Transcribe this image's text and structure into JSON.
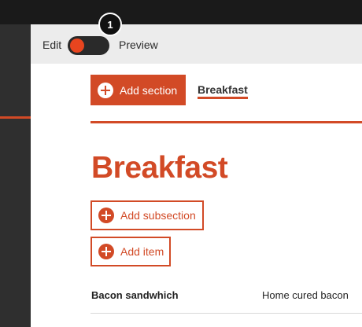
{
  "mode_switch": {
    "edit_label": "Edit",
    "preview_label": "Preview",
    "state": "edit"
  },
  "step_badge": "1",
  "toolbar": {
    "add_section_label": "Add section"
  },
  "tabs": [
    {
      "label": "Breakfast",
      "active": true
    }
  ],
  "section": {
    "title": "Breakfast",
    "add_subsection_label": "Add subsection",
    "add_item_label": "Add item",
    "items": [
      {
        "name": "Bacon sandwhich",
        "description": "Home cured bacon"
      }
    ]
  },
  "colors": {
    "accent": "#d24a26",
    "toggle_knob": "#e8451f",
    "topbar": "#1a1a1a",
    "sidebar": "#2f2f2f",
    "modebar": "#ececec"
  },
  "icons": {
    "add": "plus-circle-icon"
  }
}
